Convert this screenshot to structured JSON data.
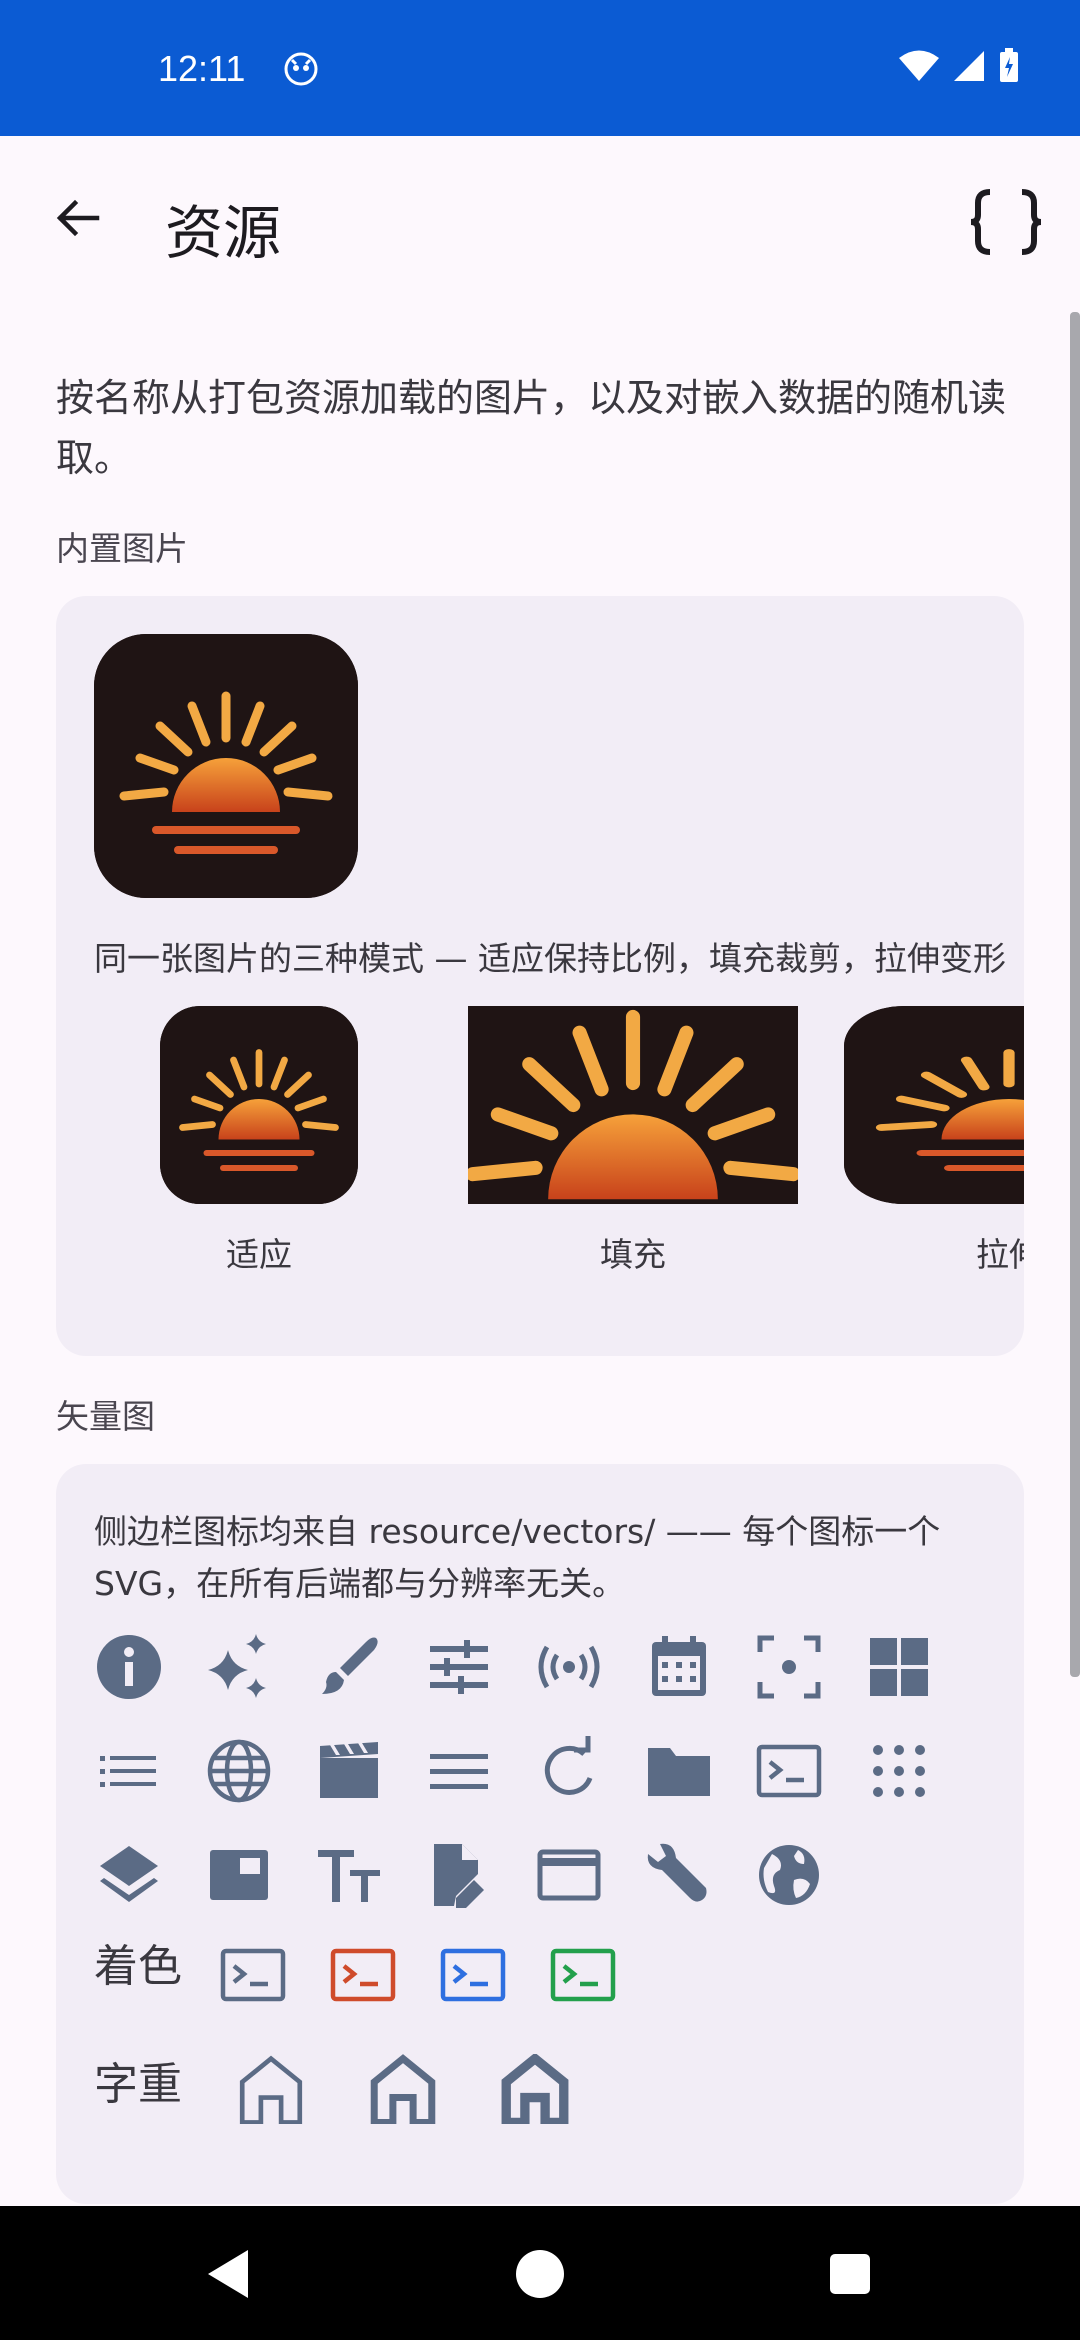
{
  "status_bar": {
    "time": "12:11"
  },
  "app_bar": {
    "title": "资源",
    "back_icon": "arrow-back-icon",
    "code_icon": "braces-icon"
  },
  "intro": "按名称从打包资源加载的图片，以及对嵌入数据的随机读取。",
  "images_section": {
    "label": "内置图片",
    "modes_caption": "同一张图片的三种模式 — 适应保持比例，填充裁剪，拉伸变形",
    "modes": [
      {
        "label": "适应"
      },
      {
        "label": "填充"
      },
      {
        "label": "拉伸"
      }
    ]
  },
  "vectors_section": {
    "label": "矢量图",
    "caption": "侧边栏图标均来自 resource/vectors/ —— 每个图标一个 SVG，在所有后端都与分辨率无关。",
    "icons_row1": [
      "info-icon",
      "sparkles-icon",
      "brush-icon",
      "tune-icon",
      "broadcast-icon",
      "calendar-icon",
      "focus-icon",
      "grid-icon"
    ],
    "icons_row2": [
      "list-icon",
      "globe-icon",
      "clapperboard-icon",
      "menu-icon",
      "refresh-icon",
      "folder-icon",
      "terminal-icon",
      "dots-grid-icon"
    ],
    "icons_row3": [
      "layers-icon",
      "window-tile-icon",
      "text-size-icon",
      "file-edit-icon",
      "window-icon",
      "wrench-icon",
      "earth-icon"
    ],
    "tint_label": "着色",
    "tint_colors": [
      "#5b6b85",
      "#cf4b2b",
      "#2e6fe0",
      "#23a04c"
    ],
    "weight_label": "字重"
  },
  "colors": {
    "status_bar": "#0b5bd3",
    "icon": "#5b6b85",
    "card": "#f2edf6"
  }
}
